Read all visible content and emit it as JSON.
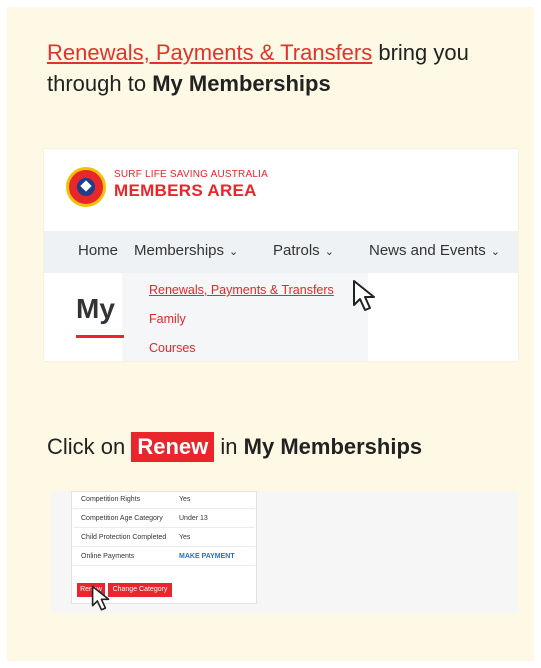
{
  "step1": {
    "link_text": "Renewals, Payments & Transfers",
    "middle_text": " bring you through to ",
    "bold_text": "My Memberships"
  },
  "screenshot1": {
    "brand_small": "SURF LIFE SAVING AUSTRALIA",
    "brand_big": "MEMBERS AREA",
    "nav": {
      "home": "Home",
      "memberships": "Memberships",
      "patrols": "Patrols",
      "news": "News and Events",
      "chevron": "⌄"
    },
    "dropdown": [
      "Renewals, Payments & Transfers",
      "Family",
      "Courses"
    ],
    "page_heading": "My"
  },
  "step2": {
    "prefix": "Click on ",
    "chip": "Renew",
    "middle": " in ",
    "bold_text": "My Memberships"
  },
  "screenshot2": {
    "rows": [
      {
        "label": "Competition Rights",
        "value": "Yes"
      },
      {
        "label": "Competition Age Category",
        "value": "Under 13"
      },
      {
        "label": "Child Protection Completed",
        "value": "Yes"
      },
      {
        "label": "Online Payments",
        "value": "MAKE PAYMENT"
      }
    ],
    "renew_button": "Renew",
    "change_button": "Change Category"
  },
  "colors": {
    "brand_red": "#e8262b",
    "card_bg": "#fdf9e4",
    "link_blue": "#2a6fbe"
  },
  "icons": [
    "cursor-arrow-icon",
    "slsa-logo-icon"
  ]
}
